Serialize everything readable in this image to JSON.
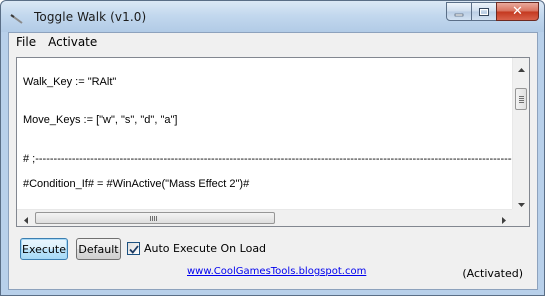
{
  "window": {
    "title": "Toggle Walk (v1.0)",
    "icon": "pen-icon",
    "controls": {
      "minimize": "minimize-icon",
      "maximize": "maximize-icon",
      "close_label": "✕"
    }
  },
  "menu": {
    "items": [
      "File",
      "Activate"
    ]
  },
  "editor": {
    "lines": [
      "Walk_Key := \"RAlt\"",
      "Move_Keys := [\"w\", \"s\", \"d\", \"a\"]",
      "# ;------------------------------------------------------------------------------------------------------------------------------------------",
      "#Condition_If# = #WinActive(\"Mass Effect 2\")#"
    ]
  },
  "controls": {
    "execute_label": "Execute",
    "default_label": "Default",
    "auto_execute_label": "Auto Execute On Load",
    "auto_execute_checked": true,
    "link_text": "www.CoolGamesTools.blogspot.com",
    "status_text": "(Activated)"
  },
  "colors": {
    "link": "#0000ee",
    "close_button": "#c4381f",
    "focus_border": "#3c7fb1"
  }
}
